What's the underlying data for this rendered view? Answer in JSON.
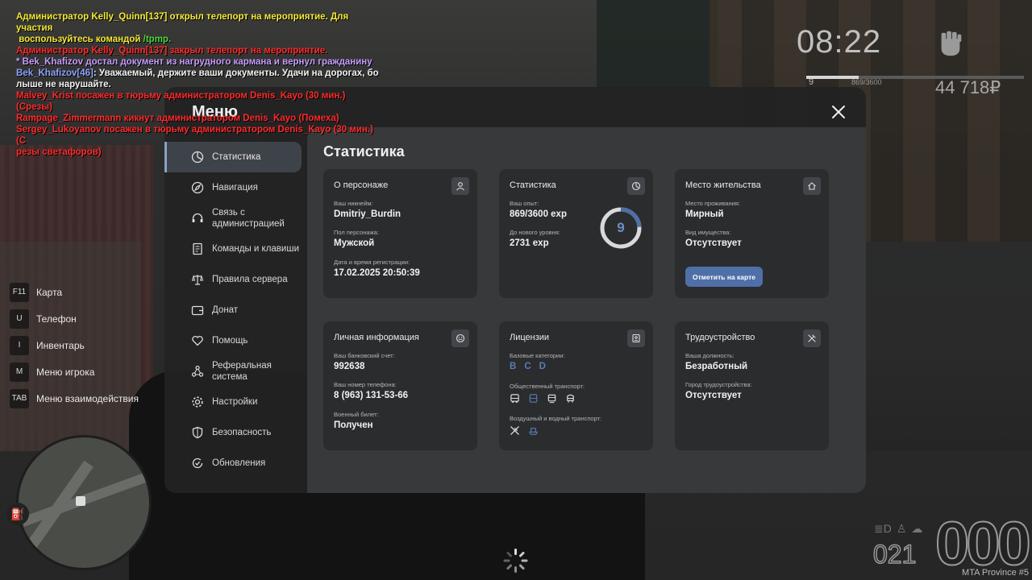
{
  "chat": [
    {
      "parts": [
        {
          "t": "Администратор Kelly_Quinn[137] открыл телепорт на мероприятие. Для участия\n воспользуйтесь командой ",
          "c": "yellow"
        },
        {
          "t": "/tpmp.",
          "c": "green"
        }
      ]
    },
    {
      "parts": [
        {
          "t": "Администратор Kelly_Quinn[137] закрыл телепорт на мероприятие.",
          "c": "red"
        }
      ]
    },
    {
      "parts": [
        {
          "t": "* Bek_Khafizov достал документ из нагрудного кармана и вернул гражданину",
          "c": "violet"
        }
      ]
    },
    {
      "parts": [
        {
          "t": "Bek_Khafizov[46]",
          "c": "blue"
        },
        {
          "t": ": Уважаемый, держите ваши документы. Удачи на дорогах, бо\nлыше не нарушайте.",
          "c": "white"
        }
      ]
    },
    {
      "parts": [
        {
          "t": "Malvey_Krist посажен в тюрьму администратором Denis_Kayo (30 мин.) (Срезы)",
          "c": "red"
        }
      ]
    },
    {
      "parts": [
        {
          "t": "Rampage_Zimmermann кикнут администратором Denis_Kayo (Помеха)",
          "c": "red"
        }
      ]
    },
    {
      "parts": [
        {
          "t": "Sergey_Lukoyanov посажен в тюрьму администратором Denis_Kayo (30 мин.) (С\nрезы светафоров)",
          "c": "red"
        }
      ]
    }
  ],
  "hud": {
    "time": "08:22",
    "level": "9",
    "exp": "869/3600",
    "exp_fraction": 0.241,
    "money": "44 718₽",
    "speed": "000",
    "gear": "021",
    "server": "MTA Province #5"
  },
  "keys": [
    {
      "key": "F11",
      "label": "Карта"
    },
    {
      "key": "U",
      "label": "Телефон"
    },
    {
      "key": "I",
      "label": "Инвентарь"
    },
    {
      "key": "M",
      "label": "Меню игрока"
    },
    {
      "key": "TAB",
      "label": "Меню взаимодействия"
    }
  ],
  "menu": {
    "title": "Меню",
    "nav": [
      {
        "id": "stats",
        "label": "Статистика",
        "icon": "pie-chart-icon",
        "active": true
      },
      {
        "id": "navigation",
        "label": "Навигация",
        "icon": "compass-icon"
      },
      {
        "id": "contact-admin",
        "label": "Связь с администрацией",
        "icon": "headset-icon"
      },
      {
        "id": "commands",
        "label": "Команды и клавиши",
        "icon": "document-icon"
      },
      {
        "id": "rules",
        "label": "Правила сервера",
        "icon": "scales-icon"
      },
      {
        "id": "donate",
        "label": "Донат",
        "icon": "wallet-icon"
      },
      {
        "id": "help",
        "label": "Помощь",
        "icon": "heart-hands-icon"
      },
      {
        "id": "referral",
        "label": "Реферальная система",
        "icon": "network-icon"
      },
      {
        "id": "settings",
        "label": "Настройки",
        "icon": "gear-icon"
      },
      {
        "id": "security",
        "label": "Безопасность",
        "icon": "shield-icon"
      },
      {
        "id": "updates",
        "label": "Обновления",
        "icon": "refresh-check-icon"
      }
    ]
  },
  "stats": {
    "title": "Статистика",
    "character": {
      "title": "О персонаже",
      "nickname_label": "Ваш никнейм:",
      "nickname": "Dmitriy_Burdin",
      "gender_label": "Пол персонажа:",
      "gender": "Мужской",
      "reg_label": "Дата и время регистрации:",
      "reg": "17.02.2025 20:50:39"
    },
    "statistics": {
      "title": "Статистика",
      "exp_label": "Ваш опыт:",
      "exp": "869/3600 exp",
      "next_label": "До нового уровня:",
      "next": "2731 exp",
      "level": "9",
      "progress": 0.241
    },
    "residence": {
      "title": "Место жительства",
      "place_label": "Место проживания:",
      "place": "Мирный",
      "property_label": "Вид имущества:",
      "property": "Отсутствует",
      "button": "Отметить на карте"
    },
    "personal": {
      "title": "Личная информация",
      "bank_label": "Ваш банковский счет:",
      "bank": "992638",
      "phone_label": "Ваш номер телефона:",
      "phone": "8 (963) 131-53-66",
      "military_label": "Военный билет:",
      "military": "Получен"
    },
    "licenses": {
      "title": "Лицензии",
      "base_label": "Базовые категории:",
      "categories": [
        "B",
        "C",
        "D"
      ],
      "public_label": "Общественный транспорт:",
      "air_label": "Воздушный и водный транспорт:"
    },
    "employment": {
      "title": "Трудоустройство",
      "position_label": "Ваша должность:",
      "position": "Безработный",
      "city_label": "Город трудоустройства:",
      "city": "Отсутствует"
    }
  },
  "colors": {
    "accent": "#4f6fa8",
    "license_active": "#5b7cb8",
    "chat_red": "#ff2a2a",
    "chat_yellow": "#f5e936"
  }
}
